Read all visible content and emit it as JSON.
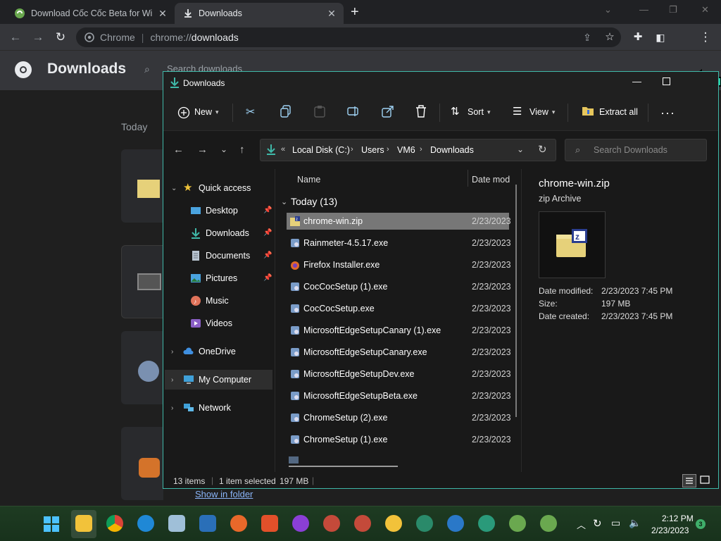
{
  "browser": {
    "tabs": [
      {
        "title": "Download Cốc Cốc Beta for Windows"
      },
      {
        "title": "Downloads"
      }
    ],
    "omnibox": {
      "site_chip": "Chrome",
      "url_scheme": "chrome://",
      "url_host": "downloads"
    }
  },
  "downloads_page": {
    "title": "Downloads",
    "search_placeholder": "Search downloads",
    "section_label": "Today",
    "show_in_folder": "Show in folder"
  },
  "explorer": {
    "title": "Downloads",
    "commands": {
      "new": "New",
      "sort": "Sort",
      "view": "View",
      "extract_all": "Extract all"
    },
    "breadcrumb": [
      "Local Disk (C:)",
      "Users",
      "VM6",
      "Downloads"
    ],
    "search_placeholder": "Search Downloads",
    "nav": {
      "quick_access": "Quick access",
      "items": [
        {
          "label": "Desktop"
        },
        {
          "label": "Downloads"
        },
        {
          "label": "Documents"
        },
        {
          "label": "Pictures"
        },
        {
          "label": "Music"
        },
        {
          "label": "Videos"
        }
      ],
      "onedrive": "OneDrive",
      "my_computer": "My Computer",
      "network": "Network"
    },
    "columns": {
      "name": "Name",
      "date": "Date mod"
    },
    "group_label": "Today (13)",
    "files": [
      {
        "name": "chrome-win.zip",
        "date": "2/23/2023"
      },
      {
        "name": "Rainmeter-4.5.17.exe",
        "date": "2/23/2023"
      },
      {
        "name": "Firefox Installer.exe",
        "date": "2/23/2023"
      },
      {
        "name": "CocCocSetup (1).exe",
        "date": "2/23/2023"
      },
      {
        "name": "CocCocSetup.exe",
        "date": "2/23/2023"
      },
      {
        "name": "MicrosoftEdgeSetupCanary (1).exe",
        "date": "2/23/2023"
      },
      {
        "name": "MicrosoftEdgeSetupCanary.exe",
        "date": "2/23/2023"
      },
      {
        "name": "MicrosoftEdgeSetupDev.exe",
        "date": "2/23/2023"
      },
      {
        "name": "MicrosoftEdgeSetupBeta.exe",
        "date": "2/23/2023"
      },
      {
        "name": "ChromeSetup (2).exe",
        "date": "2/23/2023"
      },
      {
        "name": "ChromeSetup (1).exe",
        "date": "2/23/2023"
      }
    ],
    "preview": {
      "name": "chrome-win.zip",
      "type": "zip Archive",
      "date_modified_label": "Date modified:",
      "date_modified": "2/23/2023 7:45 PM",
      "size_label": "Size:",
      "size": "197 MB",
      "date_created_label": "Date created:",
      "date_created": "2/23/2023 7:45 PM"
    },
    "status": {
      "items": "13 items",
      "selected": "1 item selected",
      "size": "197 MB"
    }
  },
  "taskbar": {
    "time": "2:12 PM",
    "date": "2/23/2023",
    "notifications": "3"
  },
  "colors": {
    "accent": "#3fb8a8",
    "selection": "#777777",
    "link": "#8ab4f8"
  }
}
